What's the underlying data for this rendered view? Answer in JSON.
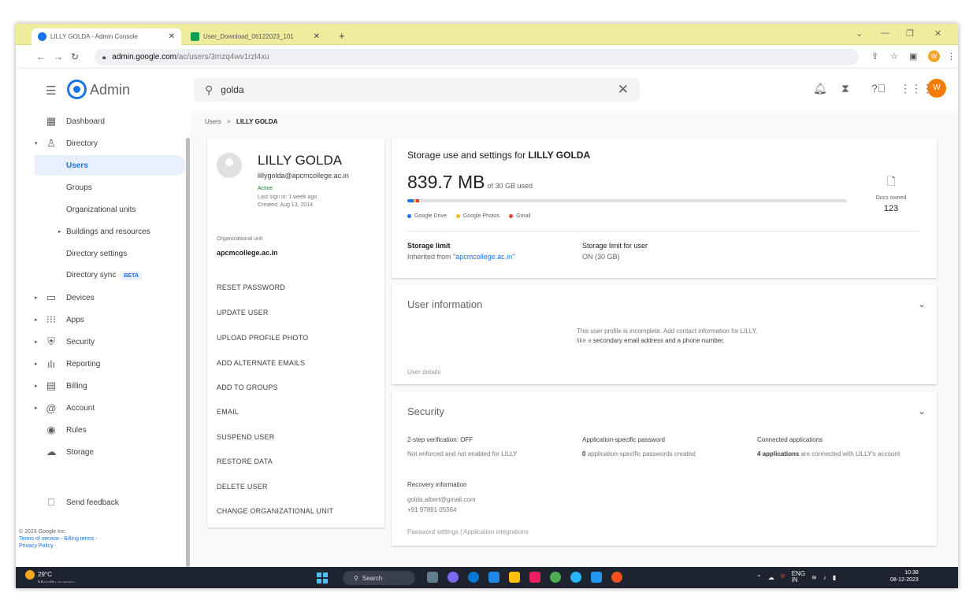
{
  "browser": {
    "tabs": [
      {
        "title": "LILLY GOLDA - Admin Console"
      },
      {
        "title": "User_Download_06122023_101"
      }
    ],
    "url_host": "admin.google.com",
    "url_path": "/ac/users/3mzq4wv1rzl4xu"
  },
  "header": {
    "app_title": "Admin",
    "search_value": "golda",
    "avatar_letter": "W"
  },
  "sidebar": {
    "items": [
      {
        "label": "Dashboard"
      },
      {
        "label": "Directory"
      },
      {
        "label": "Users"
      },
      {
        "label": "Groups"
      },
      {
        "label": "Organizational units"
      },
      {
        "label": "Buildings and resources"
      },
      {
        "label": "Directory settings"
      },
      {
        "label": "Directory sync"
      },
      {
        "label": "Devices"
      },
      {
        "label": "Apps"
      },
      {
        "label": "Security"
      },
      {
        "label": "Reporting"
      },
      {
        "label": "Billing"
      },
      {
        "label": "Account"
      },
      {
        "label": "Rules"
      },
      {
        "label": "Storage"
      }
    ],
    "beta_badge": "BETA",
    "feedback": "Send feedback",
    "footer_copyright": "© 2023 Google Inc.",
    "footer_terms": "Terms of service - Billing terms -",
    "footer_privacy": "Privacy Policy"
  },
  "breadcrumb": {
    "root": "Users",
    "sep": ">",
    "current": "LILLY GOLDA"
  },
  "user": {
    "name": "LILLY GOLDA",
    "email": "lillygolda@apcmcollege.ac.in",
    "status": "Active",
    "last_sign_in": "Last sign in: 1 week ago",
    "created": "Created: Aug 13, 2014",
    "org_unit_label": "Organizational unit",
    "org_unit": "apcmcollege.ac.in",
    "actions": [
      "RESET PASSWORD",
      "UPDATE USER",
      "UPLOAD PROFILE PHOTO",
      "ADD ALTERNATE EMAILS",
      "ADD TO GROUPS",
      "EMAIL",
      "SUSPEND USER",
      "RESTORE DATA",
      "DELETE USER",
      "CHANGE ORGANIZATIONAL UNIT"
    ]
  },
  "storage": {
    "title_prefix": "Storage use and settings for",
    "title_name": "LILLY GOLDA",
    "used": "839.7 MB",
    "total": "of 30 GB used",
    "legend": [
      {
        "label": "Google Drive",
        "color": "#1a73e8"
      },
      {
        "label": "Google Photos",
        "color": "#fbbc04"
      },
      {
        "label": "Gmail",
        "color": "#ea4335"
      }
    ],
    "usage_fraction": 0.027,
    "docs_label": "Docs owned",
    "docs_value": "123",
    "limit_label": "Storage limit",
    "limit_value_prefix": "Inherited from",
    "limit_value_link": "\"apcmcollege.ac.in\"",
    "user_limit_label": "Storage limit for user",
    "user_limit_value": "ON (30 GB)"
  },
  "user_information": {
    "title": "User information",
    "message_1": "This user profile is incomplete. Add contact information for LILLY, like a",
    "message_bold": "secondary email address and a phone number.",
    "details_link": "User details"
  },
  "security": {
    "title": "Security",
    "two_step_label": "2-step verification: OFF",
    "two_step_value": "Not enforced and not enabled for LILLY",
    "app_pw_label": "Application-specific password",
    "app_pw_count": "0",
    "app_pw_value": "application-specific passwords created",
    "connected_label": "Connected applications",
    "connected_bold": "4 applications",
    "connected_value": "are connected with LILLY's account",
    "recovery_label": "Recovery information",
    "recovery_email": "golda.albert@gmail.com",
    "recovery_phone": "+91 97891 05564",
    "links": "Password settings | Application integrations"
  },
  "taskbar": {
    "temperature": "29°C",
    "weather": "Mostly sunny",
    "search": "Search",
    "lang": "ENG",
    "region": "IN",
    "time": "10:38",
    "date": "08-12-2023"
  }
}
